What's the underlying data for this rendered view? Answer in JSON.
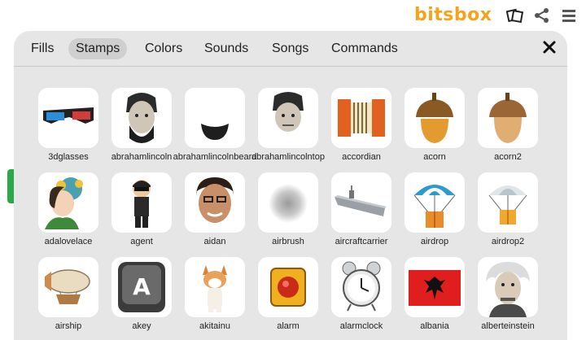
{
  "app": {
    "logo": "bitsbox"
  },
  "tabs": [
    {
      "label": "Fills"
    },
    {
      "label": "Stamps",
      "active": true
    },
    {
      "label": "Colors"
    },
    {
      "label": "Sounds"
    },
    {
      "label": "Songs"
    },
    {
      "label": "Commands"
    }
  ],
  "stamps": [
    {
      "name": "3dglasses",
      "icon": "3d-glasses-icon"
    },
    {
      "name": "abrahamlincoln",
      "icon": "lincoln-portrait-icon"
    },
    {
      "name": "abrahamlincolnbeard",
      "icon": "beard-icon"
    },
    {
      "name": "abrahamlincolntop",
      "icon": "lincoln-top-icon"
    },
    {
      "name": "accordian",
      "icon": "accordion-icon"
    },
    {
      "name": "acorn",
      "icon": "acorn-icon"
    },
    {
      "name": "acorn2",
      "icon": "acorn-flat-icon"
    },
    {
      "name": "adalovelace",
      "icon": "ada-lovelace-icon"
    },
    {
      "name": "agent",
      "icon": "agent-icon"
    },
    {
      "name": "aidan",
      "icon": "face-photo-icon"
    },
    {
      "name": "airbrush",
      "icon": "airbrush-icon"
    },
    {
      "name": "aircraftcarrier",
      "icon": "aircraft-carrier-icon"
    },
    {
      "name": "airdrop",
      "icon": "airdrop-icon"
    },
    {
      "name": "airdrop2",
      "icon": "airdrop-alt-icon"
    },
    {
      "name": "airship",
      "icon": "airship-icon"
    },
    {
      "name": "akey",
      "icon": "a-key-icon"
    },
    {
      "name": "akitainu",
      "icon": "akita-dog-icon"
    },
    {
      "name": "alarm",
      "icon": "alarm-button-icon"
    },
    {
      "name": "alarmclock",
      "icon": "alarm-clock-icon"
    },
    {
      "name": "albania",
      "icon": "albania-flag-icon"
    },
    {
      "name": "alberteinstein",
      "icon": "einstein-icon"
    }
  ],
  "colors": {
    "accent": "#f5a31a",
    "panel": "#e6e6e6",
    "tab_active": "#cfcfcf",
    "green_tab": "#2aa84a"
  }
}
